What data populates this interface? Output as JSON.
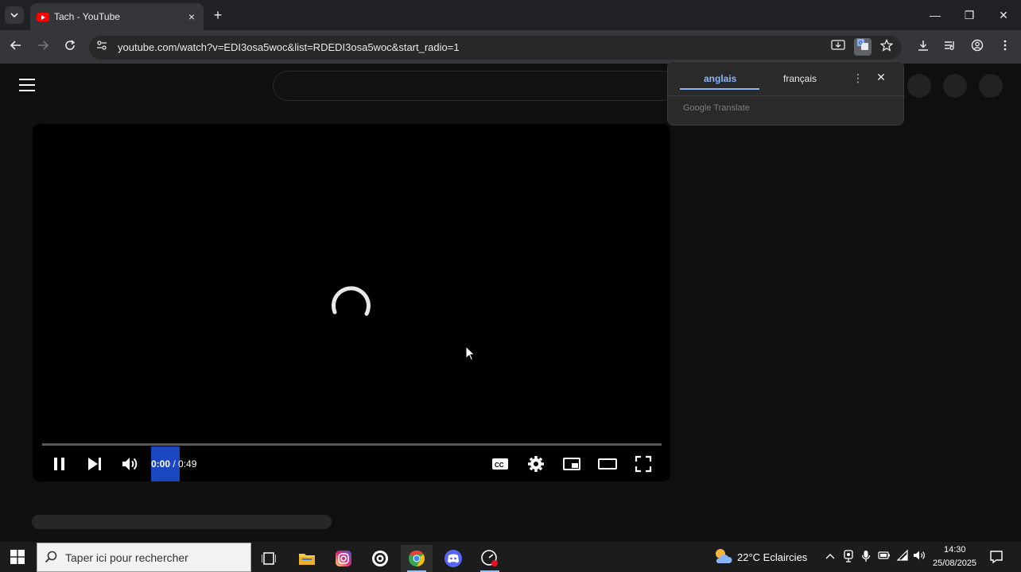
{
  "browser": {
    "tab_title": "Tach - YouTube",
    "tab_close": "×",
    "new_tab": "+",
    "url": "youtube.com/watch?v=EDI3osa5woc&list=RDEDI3osa5woc&start_radio=1",
    "window": {
      "minimize": "—",
      "restore": "❐",
      "close": "✕"
    }
  },
  "translate_popup": {
    "source_language": "anglais",
    "target_language": "français",
    "brand": "Google Translate",
    "close": "✕",
    "menu": "⋮"
  },
  "player": {
    "state": "buffering",
    "current_time": "0:00",
    "separator": " / ",
    "duration": "0:49",
    "progress_fraction": 0.0
  },
  "taskbar": {
    "search_placeholder": "Taper ici pour rechercher",
    "weather_temp": "22°C",
    "weather_desc": "Eclaircies",
    "clock_time": "14:30",
    "clock_date": "25/08/2025",
    "apps": [
      "task-view",
      "file-explorer",
      "instagram",
      "app-target",
      "chrome",
      "discord",
      "screen-recorder"
    ]
  },
  "colors": {
    "youtube_red": "#ff0000",
    "accent_blue": "#8ab4f8",
    "time_highlight": "#1a46c0",
    "page_bg": "#0f0f0f"
  }
}
